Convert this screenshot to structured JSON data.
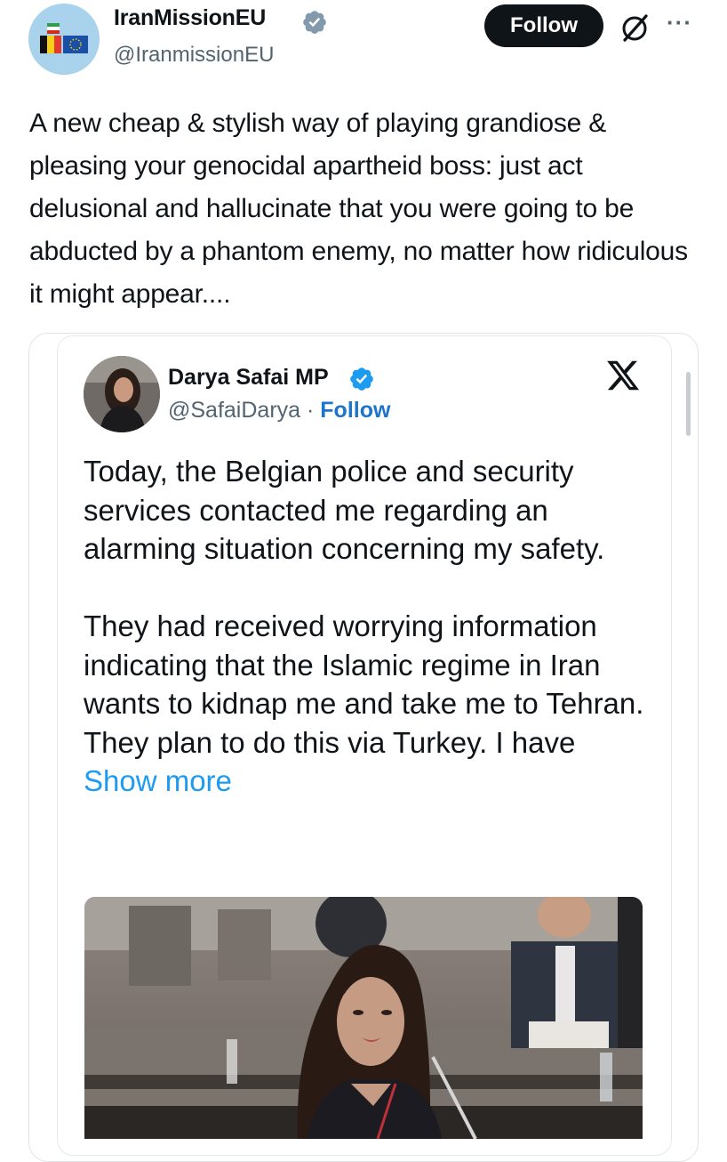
{
  "post": {
    "display_name": "IranMissionEU",
    "handle": "@IranmissionEU",
    "follow_label": "Follow",
    "more_label": "···",
    "text": "A new cheap & stylish way of playing grandiose & pleasing your genocidal apartheid boss: just act delusional and hallucinate that you were going to be abducted by a phantom enemy, no matter how ridiculous it might appear...."
  },
  "embedded": {
    "display_name": "Darya Safai MP",
    "handle": "@SafaiDarya",
    "separator": " · ",
    "follow_label": "Follow",
    "para1": "Today, the Belgian police and security services contacted me regarding an alarming situation concerning my safety.",
    "para2": "They had received worrying information indicating that the Islamic regime in Iran wants to kidnap me and take me to Tehran.",
    "para3": "They plan to do this via Turkey. I have",
    "show_more": " Show more"
  },
  "colors": {
    "text": "#0f1419",
    "secondary": "#536471",
    "link": "#1d9bf0",
    "verified": "#1d9bf0",
    "follow_bg": "#0f1419"
  },
  "icons": [
    "verified-badge-icon",
    "grok-icon",
    "more-icon",
    "x-logo-icon"
  ]
}
